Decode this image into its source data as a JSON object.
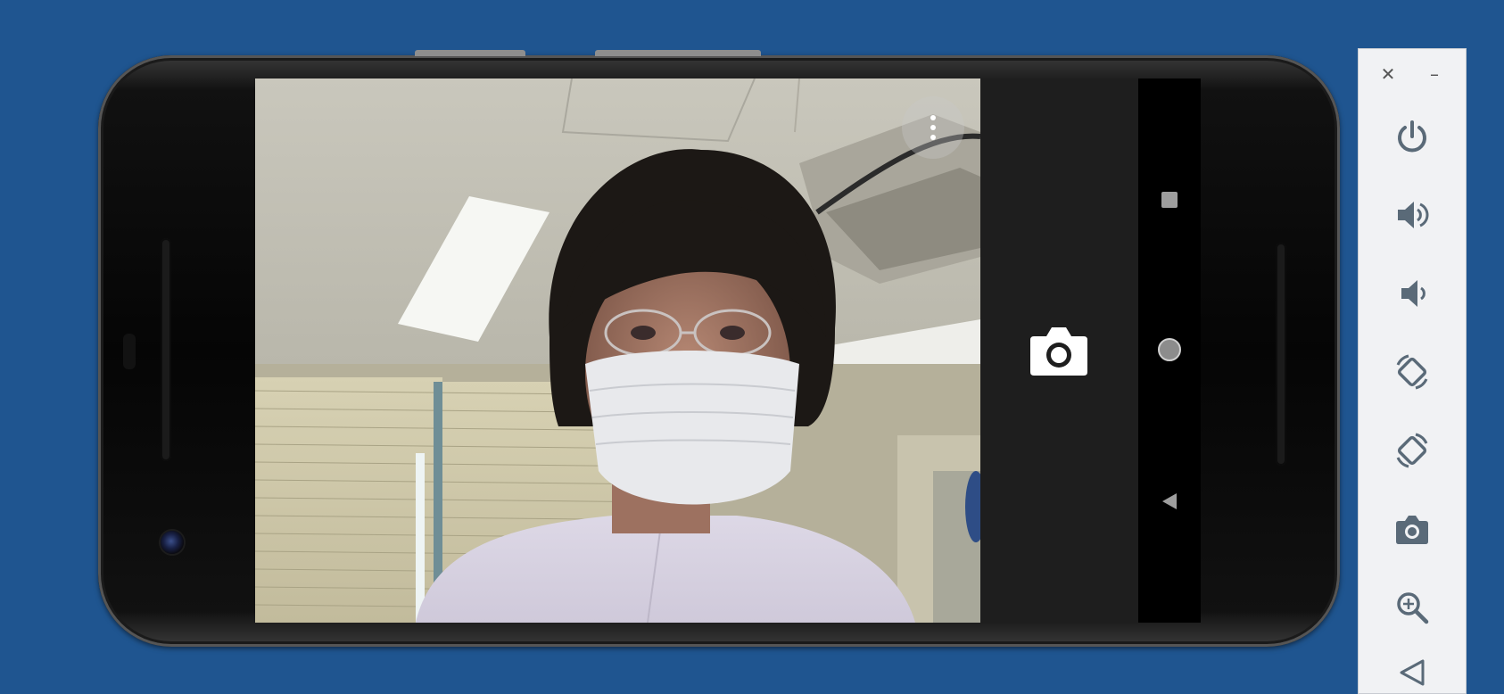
{
  "colors": {
    "desktop_bg": "#1f5590",
    "toolbar_bg": "#f1f2f4",
    "toolbar_icon": "#5a6a78",
    "camera_strip": "#1e1e1e",
    "navbar_bg": "#000000"
  },
  "phone": {
    "screen": {
      "viewfinder": {
        "content": "live-camera-preview",
        "overflow_menu_icon": "more-vert-icon"
      },
      "controls": {
        "shutter_icon": "camera-shutter-icon"
      },
      "navbar": {
        "recents_icon": "square-recents-icon",
        "home_icon": "circle-home-icon",
        "back_icon": "triangle-back-icon"
      }
    }
  },
  "toolbar": {
    "window_controls": {
      "close_glyph": "✕",
      "minimize_glyph": "–"
    },
    "buttons": [
      {
        "id": "power",
        "icon": "power-icon"
      },
      {
        "id": "volume-up",
        "icon": "volume-up-icon"
      },
      {
        "id": "volume-down",
        "icon": "volume-down-icon"
      },
      {
        "id": "rotate-left",
        "icon": "rotate-left-icon"
      },
      {
        "id": "rotate-right",
        "icon": "rotate-right-icon"
      },
      {
        "id": "screenshot",
        "icon": "camera-icon"
      },
      {
        "id": "zoom",
        "icon": "zoom-in-icon"
      },
      {
        "id": "back",
        "icon": "back-triangle-icon"
      }
    ]
  }
}
